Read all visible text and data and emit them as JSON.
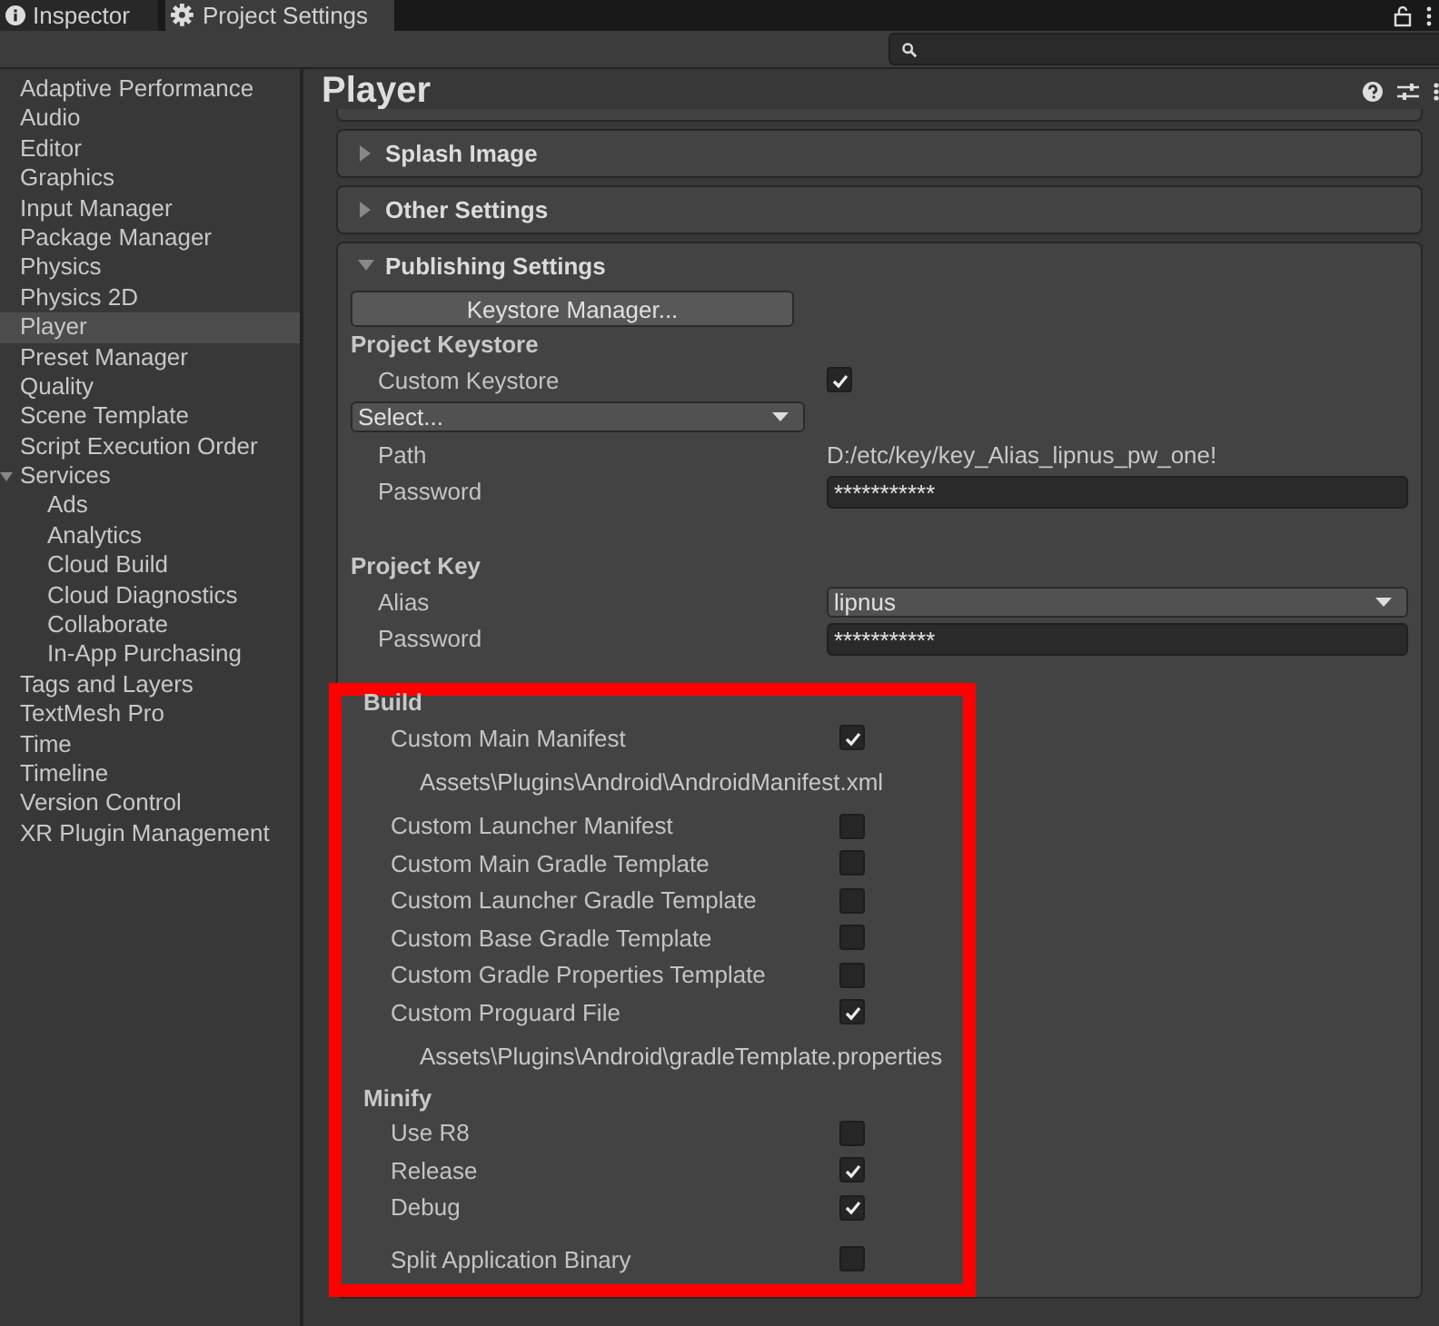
{
  "tabs": [
    {
      "label": "Inspector",
      "selected": false
    },
    {
      "label": "Project Settings",
      "selected": true
    }
  ],
  "sidebar": {
    "items": [
      {
        "label": "Adaptive Performance",
        "selected": false
      },
      {
        "label": "Audio",
        "selected": false
      },
      {
        "label": "Editor",
        "selected": false
      },
      {
        "label": "Graphics",
        "selected": false
      },
      {
        "label": "Input Manager",
        "selected": false
      },
      {
        "label": "Package Manager",
        "selected": false
      },
      {
        "label": "Physics",
        "selected": false
      },
      {
        "label": "Physics 2D",
        "selected": false
      },
      {
        "label": "Player",
        "selected": true
      },
      {
        "label": "Preset Manager",
        "selected": false
      },
      {
        "label": "Quality",
        "selected": false
      },
      {
        "label": "Scene Template",
        "selected": false
      },
      {
        "label": "Script Execution Order",
        "selected": false
      },
      {
        "label": "Services",
        "selected": false,
        "expanded": true,
        "children": [
          {
            "label": "Ads",
            "selected": false
          },
          {
            "label": "Analytics",
            "selected": false
          },
          {
            "label": "Cloud Build",
            "selected": false
          },
          {
            "label": "Cloud Diagnostics",
            "selected": false
          },
          {
            "label": "Collaborate",
            "selected": false
          },
          {
            "label": "In-App Purchasing",
            "selected": false
          }
        ]
      },
      {
        "label": "Tags and Layers",
        "selected": false
      },
      {
        "label": "TextMesh Pro",
        "selected": false
      },
      {
        "label": "Time",
        "selected": false
      },
      {
        "label": "Timeline",
        "selected": false
      },
      {
        "label": "Version Control",
        "selected": false
      },
      {
        "label": "XR Plugin Management",
        "selected": false
      }
    ]
  },
  "page_title": "Player",
  "sections": [
    {
      "title": "Splash Image",
      "expanded": false
    },
    {
      "title": "Other Settings",
      "expanded": false
    },
    {
      "title": "Publishing Settings",
      "expanded": true,
      "groups": [
        {
          "items": [
            {
              "kind": "button",
              "label": "Keystore Manager..."
            }
          ]
        },
        {
          "title": "Project Keystore",
          "items": [
            {
              "kind": "toggle",
              "label": "Custom Keystore",
              "checked": true
            },
            {
              "kind": "dropdown_wide",
              "value": "Select..."
            },
            {
              "kind": "text",
              "label": "Path",
              "value": "D:/etc/key/key_Alias_lipnus_pw_one!"
            },
            {
              "kind": "password",
              "label": "Password",
              "value": "***********"
            }
          ]
        },
        {
          "title": "Project Key",
          "items": [
            {
              "kind": "dropdown",
              "label": "Alias",
              "value": "lipnus"
            },
            {
              "kind": "password",
              "label": "Password",
              "value": "***********"
            }
          ]
        },
        {
          "title": "Build",
          "highlighted": true,
          "items": [
            {
              "kind": "toggle",
              "label": "Custom Main Manifest",
              "checked": true
            },
            {
              "kind": "path",
              "value": "Assets\\Plugins\\Android\\AndroidManifest.xml"
            },
            {
              "kind": "toggle",
              "label": "Custom Launcher Manifest",
              "checked": false
            },
            {
              "kind": "toggle",
              "label": "Custom Main Gradle Template",
              "checked": false
            },
            {
              "kind": "toggle",
              "label": "Custom Launcher Gradle Template",
              "checked": false
            },
            {
              "kind": "toggle",
              "label": "Custom Base Gradle Template",
              "checked": false
            },
            {
              "kind": "toggle",
              "label": "Custom Gradle Properties Template",
              "checked": false
            },
            {
              "kind": "toggle",
              "label": "Custom Proguard File",
              "checked": true
            },
            {
              "kind": "path",
              "value": "Assets\\Plugins\\Android\\gradleTemplate.properties"
            }
          ]
        },
        {
          "title": "Minify",
          "highlighted": true,
          "items": [
            {
              "kind": "toggle",
              "label": "Use R8",
              "checked": false
            },
            {
              "kind": "toggle",
              "label": "Release",
              "checked": true
            },
            {
              "kind": "toggle",
              "label": "Debug",
              "checked": true
            }
          ]
        },
        {
          "highlighted": true,
          "items": [
            {
              "kind": "toggle",
              "label": "Split Application Binary",
              "checked": false
            }
          ]
        }
      ]
    }
  ]
}
